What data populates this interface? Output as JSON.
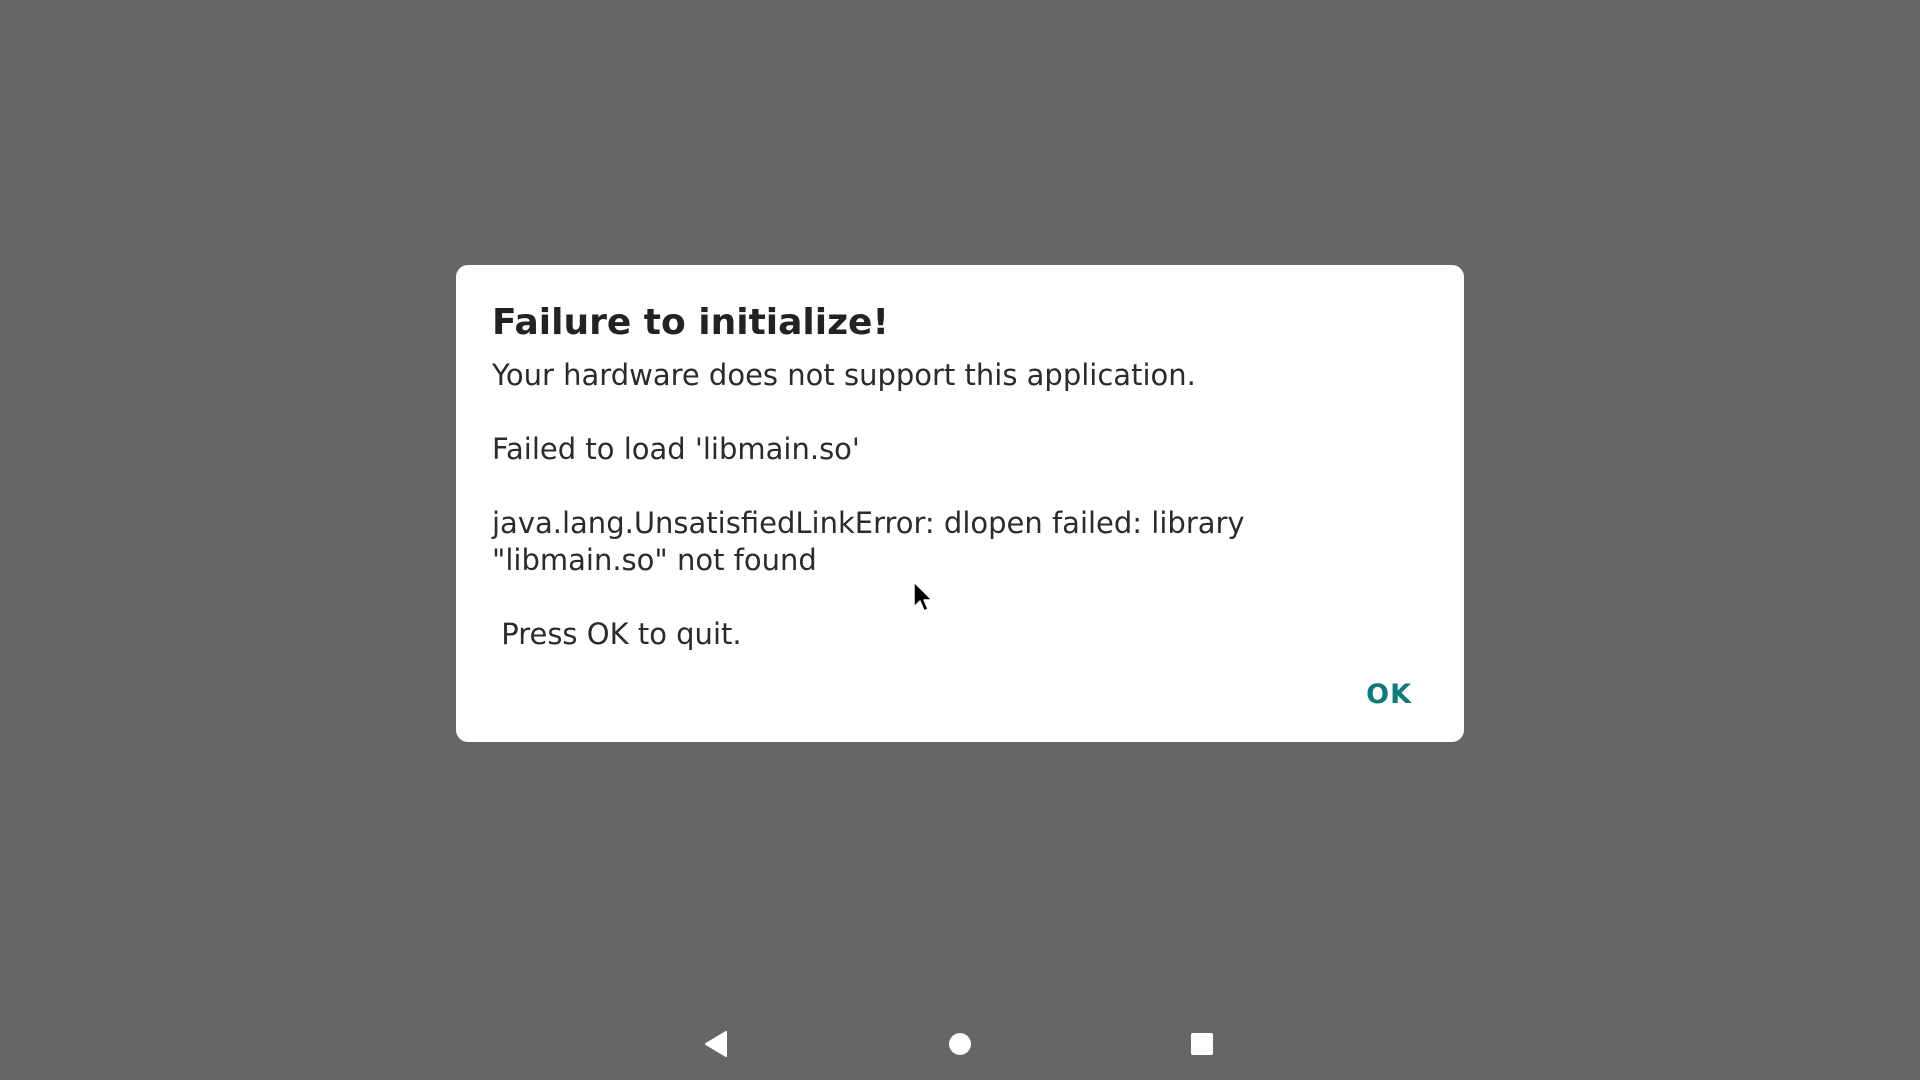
{
  "dialog": {
    "title": "Failure to initialize!",
    "message": "Your hardware does not support this application.\n\nFailed to load 'libmain.so'\n\njava.lang.UnsatisfiedLinkError: dlopen failed: library \"libmain.so\" not found\n\n Press OK to quit.",
    "ok_label": "OK",
    "accent_color": "#0e7a7a"
  },
  "navbar": {
    "back_icon": "back-triangle-icon",
    "home_icon": "home-circle-icon",
    "recents_icon": "recents-square-icon"
  },
  "colors": {
    "scrim": "#666666",
    "dialog_bg": "#ffffff"
  }
}
